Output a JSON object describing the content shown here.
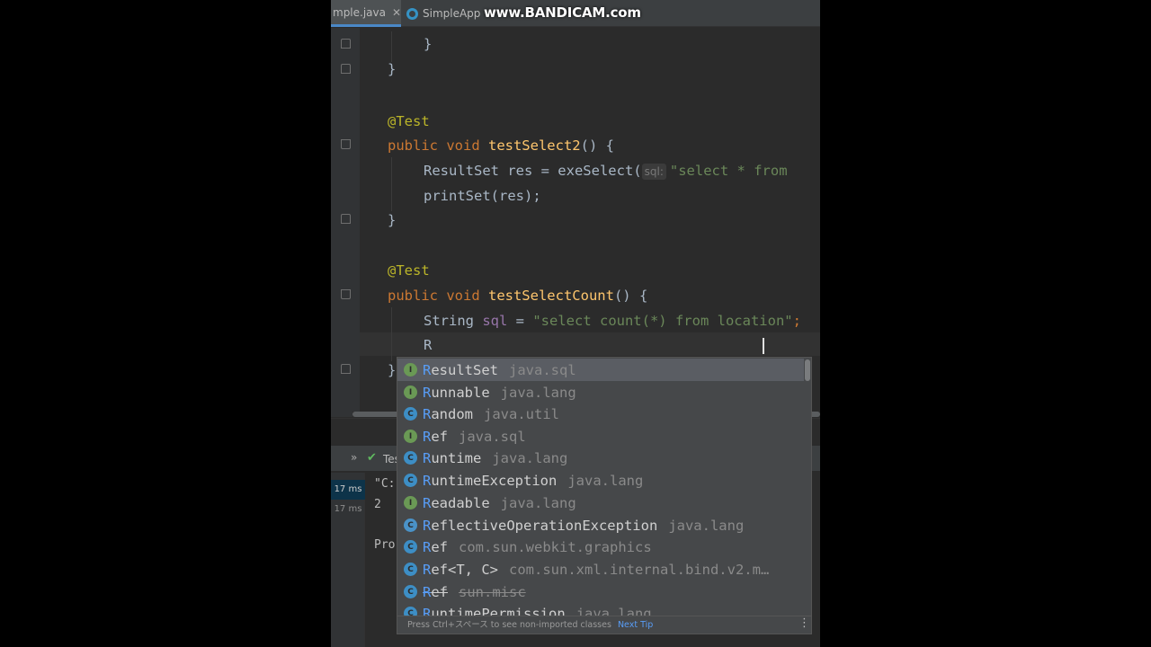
{
  "tabs": [
    {
      "label": "mple.java",
      "close": "✕"
    },
    {
      "label": "SimpleApp"
    }
  ],
  "watermark": "www.BANDICAM.com",
  "code": {
    "l1": "}",
    "l2": "}",
    "l3": "@Test",
    "l4_kw": "public void ",
    "l4_fn": "testSelect2",
    "l4_rest": "() {",
    "l5_a": "ResultSet res = exeSelect(",
    "l5_hint": "sql:",
    "l5_str": "\"select * from",
    "l6": "printSet(res);",
    "l7": "}",
    "l8": "@Test",
    "l9_kw": "public void ",
    "l9_fn": "testSelectCount",
    "l9_rest": "() {",
    "l10_a": "String ",
    "l10_var": "sql",
    "l10_b": " = ",
    "l10_str": "\"select count(*) from location\"",
    "l10_semi": ";",
    "l11": "R",
    "l12": "}"
  },
  "run": {
    "chevron": "»",
    "status": "Tes",
    "timings": [
      "17 ms",
      "17 ms"
    ],
    "console": [
      "\"C:",
      "2",
      "Pro"
    ]
  },
  "completion": {
    "items": [
      {
        "icon": "I",
        "kind": "interface",
        "match": "R",
        "rest": "esultSet",
        "pkg": "java.sql"
      },
      {
        "icon": "I",
        "kind": "interface",
        "match": "R",
        "rest": "unnable",
        "pkg": "java.lang"
      },
      {
        "icon": "C",
        "kind": "class",
        "match": "R",
        "rest": "andom",
        "pkg": "java.util"
      },
      {
        "icon": "I",
        "kind": "interface",
        "match": "R",
        "rest": "ef",
        "pkg": "java.sql"
      },
      {
        "icon": "C",
        "kind": "class",
        "match": "R",
        "rest": "untime",
        "pkg": "java.lang"
      },
      {
        "icon": "C",
        "kind": "class",
        "match": "R",
        "rest": "untimeException",
        "pkg": "java.lang"
      },
      {
        "icon": "I",
        "kind": "interface",
        "match": "R",
        "rest": "eadable",
        "pkg": "java.lang"
      },
      {
        "icon": "C",
        "kind": "abstract",
        "match": "R",
        "rest": "eflectiveOperationException",
        "pkg": "java.lang"
      },
      {
        "icon": "C",
        "kind": "class",
        "match": "R",
        "rest": "ef",
        "pkg": "com.sun.webkit.graphics"
      },
      {
        "icon": "C",
        "kind": "class",
        "match": "R",
        "rest": "ef<T, C>",
        "pkg": "com.sun.xml.internal.bind.v2.m…"
      },
      {
        "icon": "C",
        "kind": "class",
        "match": "R",
        "rest": "ef",
        "pkg": "sun.misc"
      },
      {
        "icon": "C",
        "kind": "class",
        "match": "R",
        "rest": "untimePermission",
        "pkg": "java.lang"
      }
    ],
    "footer": "Press Ctrl+スペース to see non-imported classes",
    "next_tip": "Next Tip",
    "more": "⋮"
  }
}
